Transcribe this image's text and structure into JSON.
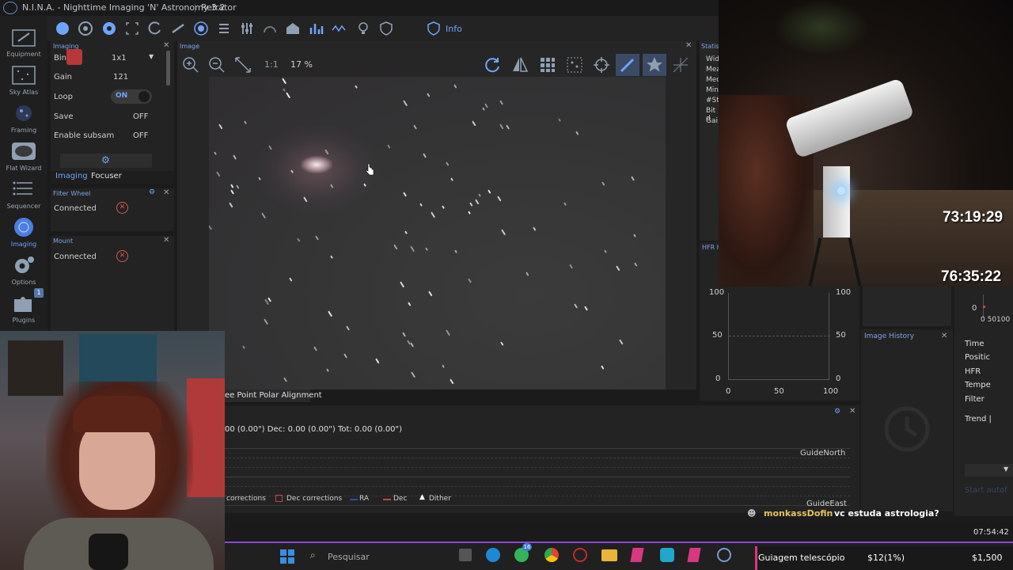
{
  "app": {
    "title": "N.I.N.A. - Nighttime Imaging 'N' Astronomy 3.2",
    "profile": "Refrator"
  },
  "leftnav": [
    {
      "label": "Equipment",
      "icon": "camera-equipment-icon"
    },
    {
      "label": "Sky Atlas",
      "icon": "sky-atlas-icon"
    },
    {
      "label": "Framing",
      "icon": "framing-icon"
    },
    {
      "label": "Flat Wizard",
      "icon": "flat-wizard-icon"
    },
    {
      "label": "Sequencer",
      "icon": "sequencer-icon"
    },
    {
      "label": "Imaging",
      "icon": "imaging-icon"
    },
    {
      "label": "Options",
      "icon": "gear-icon"
    },
    {
      "label": "Plugins",
      "icon": "puzzle-icon",
      "badge": "1"
    }
  ],
  "toolbar": {
    "info_label": "Info"
  },
  "imaging_panel": {
    "header": "Imaging",
    "rows": [
      {
        "label": "Bin",
        "value": "1x1"
      },
      {
        "label": "Gain",
        "value": "121"
      },
      {
        "label": "Loop",
        "value": "ON"
      },
      {
        "label": "Save",
        "value": "OFF"
      },
      {
        "label": "Enable subsam",
        "value": "OFF"
      }
    ],
    "tabs": [
      "Imaging",
      "Focuser"
    ]
  },
  "filter_wheel_panel": {
    "header": "Filter Wheel",
    "status": "Connected"
  },
  "mount_panel": {
    "header": "Mount",
    "status": "Connected"
  },
  "image_panel": {
    "header": "Image",
    "zoom_ratio": "1:1",
    "zoom_percent": "17 %"
  },
  "stats_panel": {
    "header": "Statist",
    "rows": [
      "Wid",
      "Mea",
      "Med",
      "Min",
      "#Sta",
      "Bit d",
      "Gai"
    ]
  },
  "hfr_panel": {
    "header": "HFR h",
    "y_left": [
      "100",
      "50",
      "0"
    ],
    "y_right": [
      "100",
      "50",
      "0"
    ],
    "x_ticks": [
      "0",
      "50",
      "100"
    ]
  },
  "history_panel": {
    "header": "Image History"
  },
  "right_table": {
    "y_value": "0",
    "x_ticks": "0 50100",
    "rows": [
      "Time",
      "Positic",
      "HFR",
      "Tempe",
      "Filter",
      "Trend |"
    ],
    "button": "Start autof"
  },
  "polar_tab": "ee Point Polar Alignment",
  "guide_panel": {
    "rms_text": "00 (0.00\")  Dec: 0.00 (0.00\")  Tot: 0.00 (0.00\")",
    "north_label": "GuideNorth",
    "east_label": "GuideEast",
    "legend": [
      "corrections",
      "Dec corrections",
      "RA",
      "Dec",
      "Dither"
    ]
  },
  "chat": {
    "user": "monkassDofin",
    "message": "vc estuda astrologia?"
  },
  "clock": "07:54:42",
  "timers": {
    "upper": "73:19:29",
    "lower": "76:35:22"
  },
  "taskbar": {
    "search_placeholder": "Pesquisar",
    "chrome_badge": "16"
  },
  "goal": {
    "title": "Guiagem telescópio",
    "raised": "$12(1%)",
    "target": "$1,500",
    "progress_fraction": 0.01
  },
  "colors": {
    "accent": "#6fa4ff",
    "red": "#e05252",
    "panel": "#232323"
  }
}
